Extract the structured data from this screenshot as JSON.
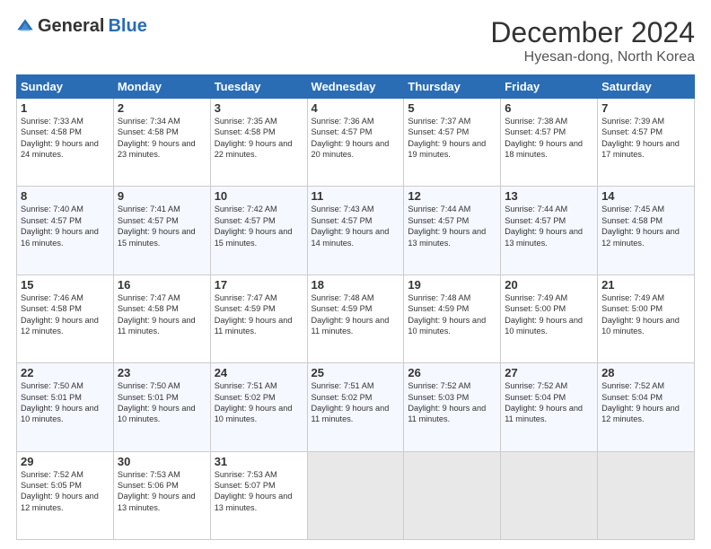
{
  "logo": {
    "general": "General",
    "blue": "Blue"
  },
  "title": "December 2024",
  "subtitle": "Hyesan-dong, North Korea",
  "days_of_week": [
    "Sunday",
    "Monday",
    "Tuesday",
    "Wednesday",
    "Thursday",
    "Friday",
    "Saturday"
  ],
  "weeks": [
    [
      {
        "day": "1",
        "sunrise": "7:33 AM",
        "sunset": "4:58 PM",
        "daylight": "9 hours and 24 minutes."
      },
      {
        "day": "2",
        "sunrise": "7:34 AM",
        "sunset": "4:58 PM",
        "daylight": "9 hours and 23 minutes."
      },
      {
        "day": "3",
        "sunrise": "7:35 AM",
        "sunset": "4:58 PM",
        "daylight": "9 hours and 22 minutes."
      },
      {
        "day": "4",
        "sunrise": "7:36 AM",
        "sunset": "4:57 PM",
        "daylight": "9 hours and 20 minutes."
      },
      {
        "day": "5",
        "sunrise": "7:37 AM",
        "sunset": "4:57 PM",
        "daylight": "9 hours and 19 minutes."
      },
      {
        "day": "6",
        "sunrise": "7:38 AM",
        "sunset": "4:57 PM",
        "daylight": "9 hours and 18 minutes."
      },
      {
        "day": "7",
        "sunrise": "7:39 AM",
        "sunset": "4:57 PM",
        "daylight": "9 hours and 17 minutes."
      }
    ],
    [
      {
        "day": "8",
        "sunrise": "7:40 AM",
        "sunset": "4:57 PM",
        "daylight": "9 hours and 16 minutes."
      },
      {
        "day": "9",
        "sunrise": "7:41 AM",
        "sunset": "4:57 PM",
        "daylight": "9 hours and 15 minutes."
      },
      {
        "day": "10",
        "sunrise": "7:42 AM",
        "sunset": "4:57 PM",
        "daylight": "9 hours and 15 minutes."
      },
      {
        "day": "11",
        "sunrise": "7:43 AM",
        "sunset": "4:57 PM",
        "daylight": "9 hours and 14 minutes."
      },
      {
        "day": "12",
        "sunrise": "7:44 AM",
        "sunset": "4:57 PM",
        "daylight": "9 hours and 13 minutes."
      },
      {
        "day": "13",
        "sunrise": "7:44 AM",
        "sunset": "4:57 PM",
        "daylight": "9 hours and 13 minutes."
      },
      {
        "day": "14",
        "sunrise": "7:45 AM",
        "sunset": "4:58 PM",
        "daylight": "9 hours and 12 minutes."
      }
    ],
    [
      {
        "day": "15",
        "sunrise": "7:46 AM",
        "sunset": "4:58 PM",
        "daylight": "9 hours and 12 minutes."
      },
      {
        "day": "16",
        "sunrise": "7:47 AM",
        "sunset": "4:58 PM",
        "daylight": "9 hours and 11 minutes."
      },
      {
        "day": "17",
        "sunrise": "7:47 AM",
        "sunset": "4:59 PM",
        "daylight": "9 hours and 11 minutes."
      },
      {
        "day": "18",
        "sunrise": "7:48 AM",
        "sunset": "4:59 PM",
        "daylight": "9 hours and 11 minutes."
      },
      {
        "day": "19",
        "sunrise": "7:48 AM",
        "sunset": "4:59 PM",
        "daylight": "9 hours and 10 minutes."
      },
      {
        "day": "20",
        "sunrise": "7:49 AM",
        "sunset": "5:00 PM",
        "daylight": "9 hours and 10 minutes."
      },
      {
        "day": "21",
        "sunrise": "7:49 AM",
        "sunset": "5:00 PM",
        "daylight": "9 hours and 10 minutes."
      }
    ],
    [
      {
        "day": "22",
        "sunrise": "7:50 AM",
        "sunset": "5:01 PM",
        "daylight": "9 hours and 10 minutes."
      },
      {
        "day": "23",
        "sunrise": "7:50 AM",
        "sunset": "5:01 PM",
        "daylight": "9 hours and 10 minutes."
      },
      {
        "day": "24",
        "sunrise": "7:51 AM",
        "sunset": "5:02 PM",
        "daylight": "9 hours and 10 minutes."
      },
      {
        "day": "25",
        "sunrise": "7:51 AM",
        "sunset": "5:02 PM",
        "daylight": "9 hours and 11 minutes."
      },
      {
        "day": "26",
        "sunrise": "7:52 AM",
        "sunset": "5:03 PM",
        "daylight": "9 hours and 11 minutes."
      },
      {
        "day": "27",
        "sunrise": "7:52 AM",
        "sunset": "5:04 PM",
        "daylight": "9 hours and 11 minutes."
      },
      {
        "day": "28",
        "sunrise": "7:52 AM",
        "sunset": "5:04 PM",
        "daylight": "9 hours and 12 minutes."
      }
    ],
    [
      {
        "day": "29",
        "sunrise": "7:52 AM",
        "sunset": "5:05 PM",
        "daylight": "9 hours and 12 minutes."
      },
      {
        "day": "30",
        "sunrise": "7:53 AM",
        "sunset": "5:06 PM",
        "daylight": "9 hours and 13 minutes."
      },
      {
        "day": "31",
        "sunrise": "7:53 AM",
        "sunset": "5:07 PM",
        "daylight": "9 hours and 13 minutes."
      },
      null,
      null,
      null,
      null
    ]
  ]
}
